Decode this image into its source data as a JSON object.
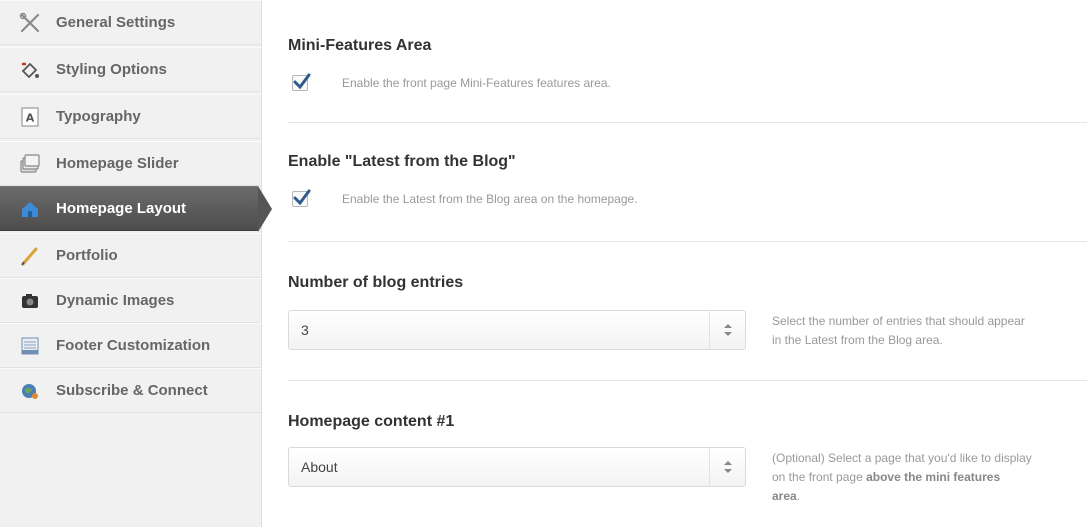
{
  "sidebar": {
    "items": [
      {
        "label": "General Settings",
        "icon": "tools-icon"
      },
      {
        "label": "Styling Options",
        "icon": "paint-bucket-icon"
      },
      {
        "label": "Typography",
        "icon": "font-icon"
      },
      {
        "label": "Homepage Slider",
        "icon": "slides-icon"
      },
      {
        "label": "Homepage Layout",
        "icon": "home-icon",
        "active": true
      },
      {
        "label": "Portfolio",
        "icon": "pencil-icon"
      },
      {
        "label": "Dynamic Images",
        "icon": "camera-icon"
      },
      {
        "label": "Footer Customization",
        "icon": "footer-icon"
      },
      {
        "label": "Subscribe & Connect",
        "icon": "globe-icon"
      }
    ]
  },
  "main": {
    "mini_features": {
      "title": "Mini-Features Area",
      "checkbox_checked": true,
      "description": "Enable the front page Mini-Features features area."
    },
    "latest_blog": {
      "title": "Enable \"Latest from the Blog\"",
      "checkbox_checked": true,
      "description": "Enable the Latest from the Blog area on the homepage."
    },
    "blog_entries": {
      "title": "Number of blog entries",
      "value": "3",
      "help_line1": "Select the number of entries that should appear",
      "help_line2": "in the Latest from the Blog area."
    },
    "homepage_content": {
      "title": "Homepage content #1",
      "value": "About",
      "help_line1": "(Optional) Select a page that you'd like to display",
      "help_line2_prefix": "on the front page ",
      "help_bold_1": "above the mini features",
      "help_bold_2": "area",
      "help_end": "."
    }
  },
  "colors": {
    "active_bg": "#555555",
    "checkmark": "#2c5b8c",
    "sidebar_bg": "#f1f1f1"
  }
}
